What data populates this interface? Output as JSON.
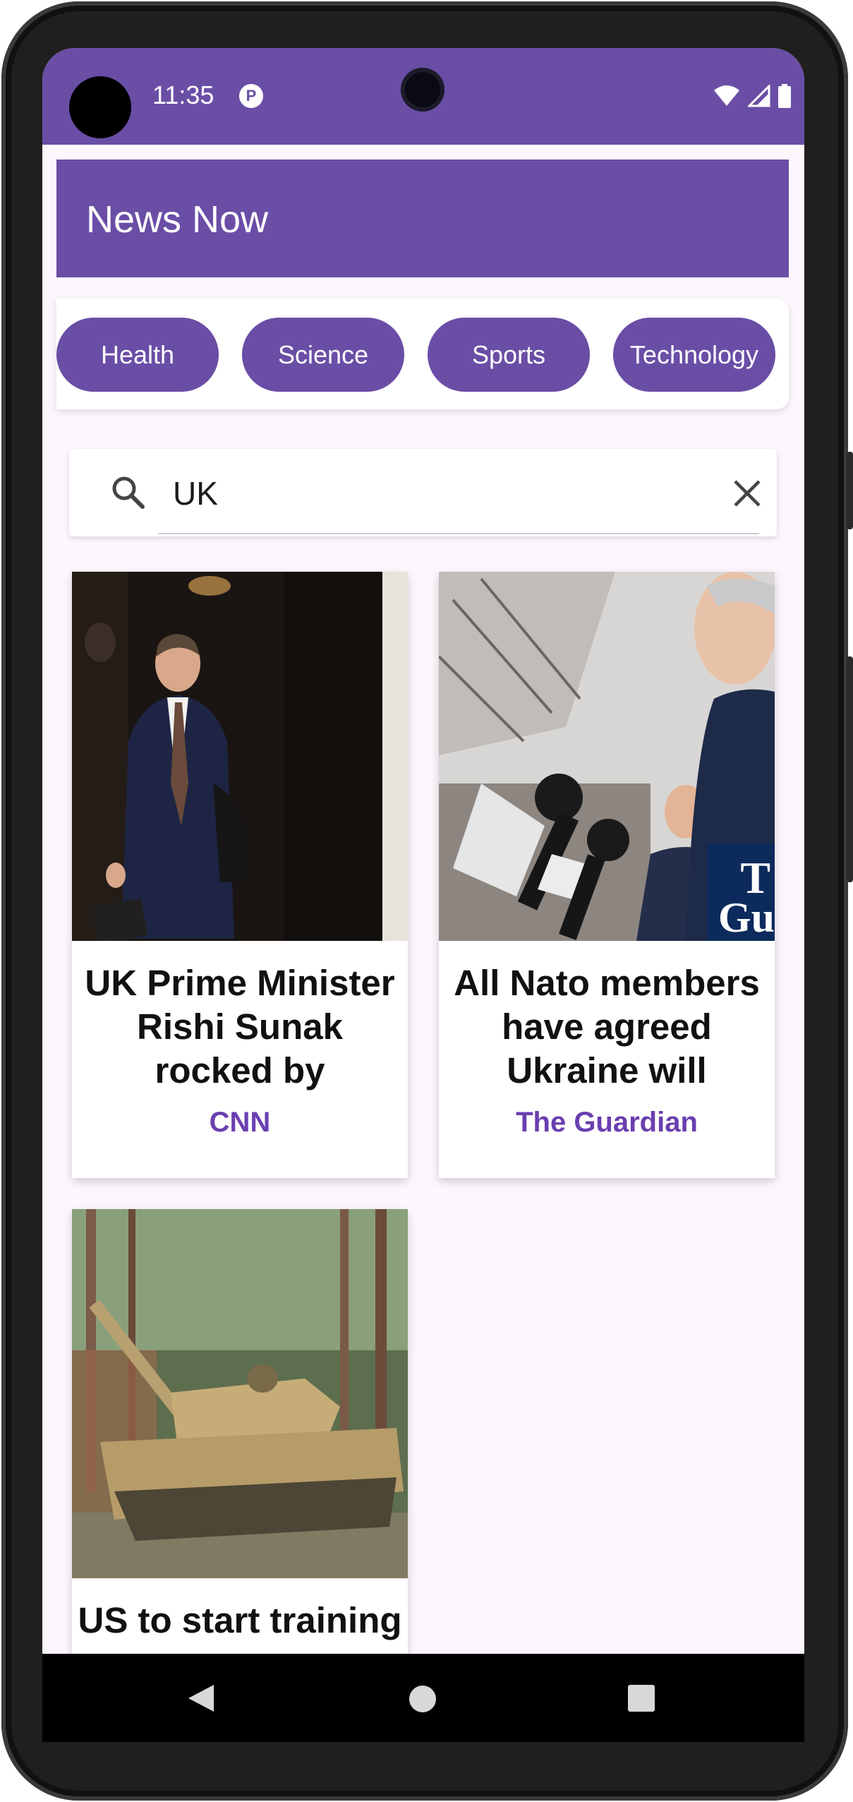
{
  "status_bar": {
    "time": "11:35"
  },
  "app_bar": {
    "title": "News Now"
  },
  "categories": [
    "Health",
    "Science",
    "Sports",
    "Technology"
  ],
  "search": {
    "value": "UK"
  },
  "articles": [
    {
      "title": "UK Prime Minister Rishi Sunak rocked by resignation of",
      "source": "CNN"
    },
    {
      "title": "All Nato members have agreed Ukraine will",
      "source": "The Guardian"
    },
    {
      "title": "US to start training",
      "source": ""
    }
  ],
  "colors": {
    "primary": "#6a4ea6",
    "source_text": "#6a3fb0",
    "background": "#fdf7fd"
  },
  "icons": [
    "search-icon",
    "clear-icon",
    "wifi-icon",
    "signal-icon",
    "battery-icon",
    "back-icon",
    "home-icon",
    "recents-icon"
  ]
}
